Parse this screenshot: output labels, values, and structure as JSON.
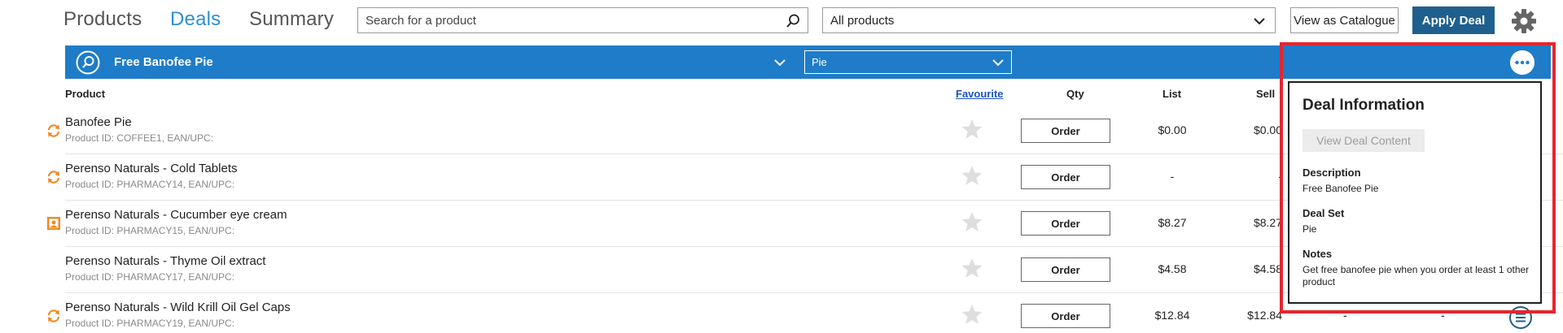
{
  "nav": {
    "tabs": [
      {
        "label": "Products",
        "active": false
      },
      {
        "label": "Deals",
        "active": true
      },
      {
        "label": "Summary",
        "active": false
      }
    ]
  },
  "search": {
    "placeholder": "Search for a product",
    "icon": "search-icon"
  },
  "product_filter": {
    "selected": "All products"
  },
  "buttons": {
    "view_catalogue": "View as Catalogue",
    "apply_deal": "Apply Deal"
  },
  "deal_bar": {
    "deal_name": "Free Banofee Pie",
    "deal_set": "Pie",
    "color": "#1e7cc8"
  },
  "table": {
    "headers": {
      "product": "Product",
      "favourite": "Favourite",
      "qty": "Qty",
      "list": "List",
      "sell": "Sell"
    },
    "rows": [
      {
        "name": "Banofee Pie",
        "meta": "Product ID: COFFEE1, EAN/UPC:",
        "status_icon": "refresh-icon",
        "order_label": "Order",
        "list": "$0.00",
        "sell": "$0.00",
        "extra1": "",
        "extra2": ""
      },
      {
        "name": "Perenso Naturals - Cold Tablets",
        "meta": "Product ID: PHARMACY14, EAN/UPC:",
        "status_icon": "refresh-icon",
        "order_label": "Order",
        "list": "-",
        "sell": "-",
        "extra1": "",
        "extra2": ""
      },
      {
        "name": "Perenso Naturals - Cucumber eye cream",
        "meta": "Product ID: PHARMACY15, EAN/UPC:",
        "status_icon": "image-icon",
        "order_label": "Order",
        "list": "$8.27",
        "sell": "$8.27",
        "extra1": "",
        "extra2": ""
      },
      {
        "name": "Perenso Naturals - Thyme Oil extract",
        "meta": "Product ID: PHARMACY17, EAN/UPC:",
        "status_icon": "",
        "order_label": "Order",
        "list": "$4.58",
        "sell": "$4.58",
        "extra1": "",
        "extra2": ""
      },
      {
        "name": "Perenso Naturals - Wild Krill Oil Gel Caps",
        "meta": "Product ID: PHARMACY19, EAN/UPC:",
        "status_icon": "refresh-icon",
        "order_label": "Order",
        "list": "$12.84",
        "sell": "$12.84",
        "extra1": "-",
        "extra2": "-"
      }
    ]
  },
  "deal_info": {
    "title": "Deal Information",
    "view_button": "View Deal Content",
    "description_label": "Description",
    "description": "Free Banofee Pie",
    "deal_set_label": "Deal Set",
    "deal_set": "Pie",
    "notes_label": "Notes",
    "notes": "Get free banofee pie when you order at least 1 other product"
  },
  "colors": {
    "accent_blue": "#1e7cc8",
    "apply_button": "#1f5f8d",
    "highlight_red": "#e5252f",
    "status_orange": "#f08a24",
    "active_tab": "#2d8fd5"
  }
}
